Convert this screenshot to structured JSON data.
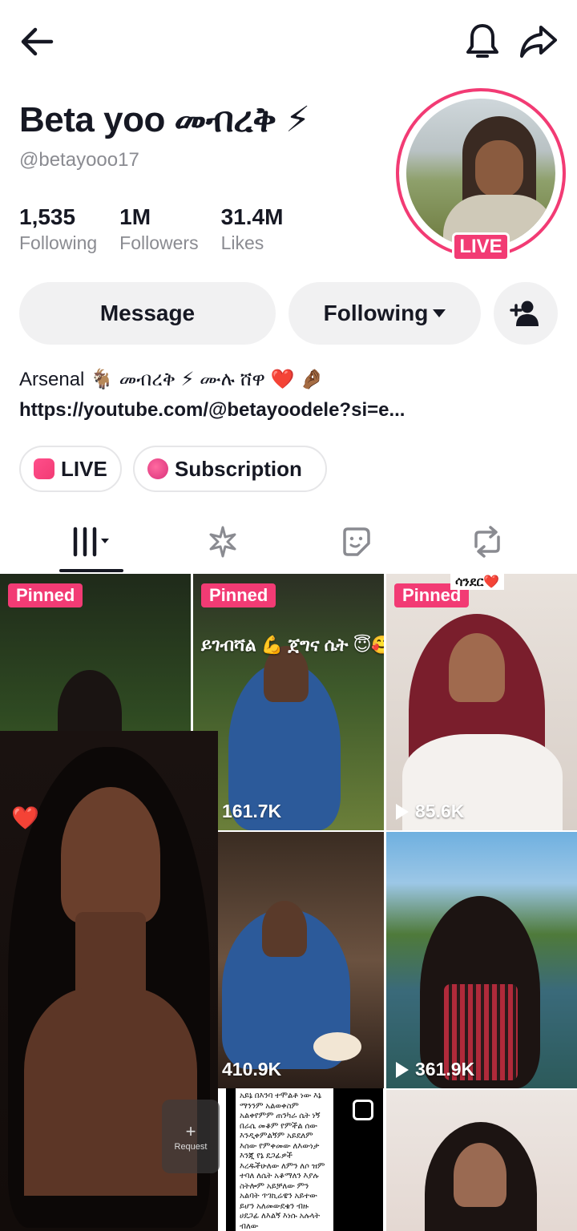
{
  "profile": {
    "name": "Beta yoo መብረቅ ⚡",
    "handle": "@betayooo17",
    "live_badge": "LIVE",
    "stats": [
      {
        "value": "1,535",
        "label": "Following"
      },
      {
        "value": "1M",
        "label": "Followers"
      },
      {
        "value": "31.4M",
        "label": "Likes"
      }
    ],
    "bio": "Arsenal 🐐 መብረቅ ⚡ ሙሉ ሸዋ ❤️ 🤌🏾",
    "link": "https://youtube.com/@betayoodele?si=e..."
  },
  "actions": {
    "message": "Message",
    "following": "Following"
  },
  "chips": {
    "live": "LIVE",
    "subscription": "Subscription"
  },
  "tabs": [
    "videos-grid",
    "reposts-sparkle",
    "stickers",
    "repost"
  ],
  "videos": [
    {
      "pinned": "Pinned",
      "views": ""
    },
    {
      "pinned": "Pinned",
      "views": "161.7K",
      "caption": "ይገብሻል 💪 ጀግና ሴት 😇🥰"
    },
    {
      "pinned": "Pinned",
      "views": "85.6K",
      "caption": "ሳንደር❤️"
    },
    {
      "views": "410.9K"
    },
    {
      "views": "361.9K"
    },
    {
      "views": ""
    }
  ],
  "overlay": {
    "request_label": "Request",
    "request_plus": "+",
    "heart": "❤️",
    "text_card": "አይኔ በእንባ ተሞልቶ ነው እኔ ማንንም አልወቀስም አልቀየምም ጠንካራ ሴት ነኝ በራሴ መቆም የምችል ሰው እንዲቀምልኝም አይደለም እሰው የምቀመው ለእውነታ እንጂ የኔ ደጋፊዎች እረዱችሁለው ለምን ለሶ ዝም ተባለ ለሴት አቆማለን እያሉ ስትሎም አይቻለው ምን አልባት ጥገኪሬዌን አይተው ይሆን አለመውደቄን ብዙ ሀደጋፊ ለእልኝ እነሱ አሉላት ብለው"
  }
}
